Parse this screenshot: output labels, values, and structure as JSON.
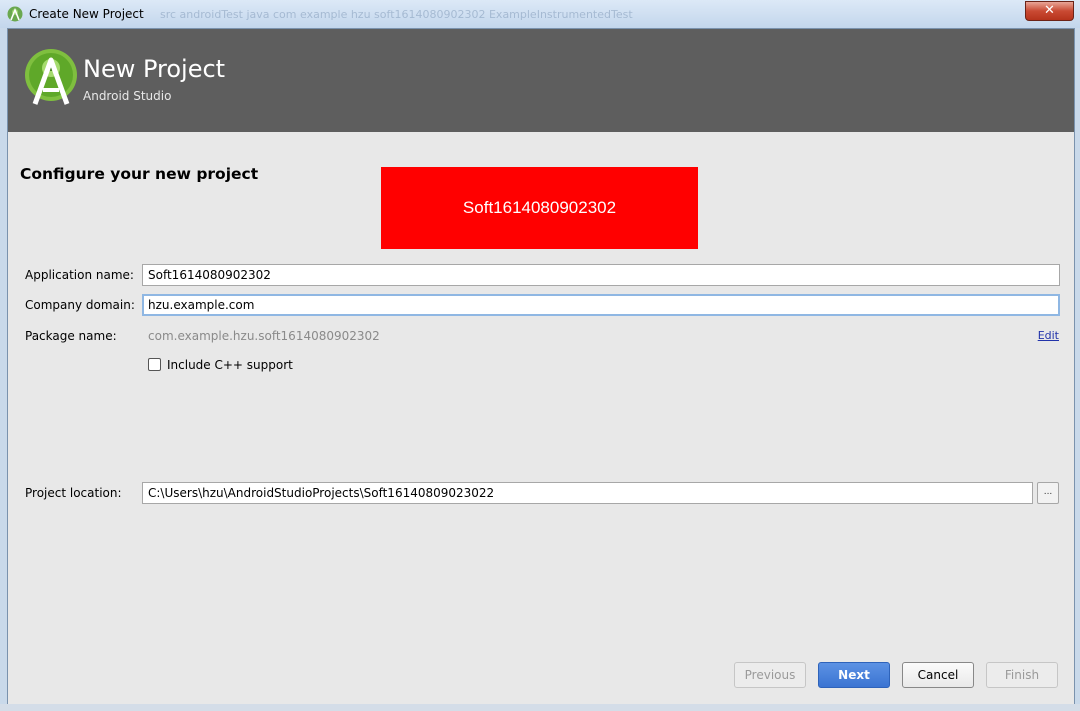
{
  "window": {
    "title": "Create New Project",
    "close_label": "✕",
    "background_crumbs": "src   androidTest   java   com   example   hzu   soft1614080902302   ExampleInstrumentedTest"
  },
  "banner": {
    "title": "New Project",
    "subtitle": "Android Studio"
  },
  "section": {
    "title": "Configure your new project"
  },
  "red_box_text": "Soft1614080902302",
  "form": {
    "app_name_label": "Application name:",
    "app_name_value": "Soft1614080902302",
    "company_domain_label": "Company domain:",
    "company_domain_value": "hzu.example.com",
    "package_name_label": "Package name:",
    "package_name_value": "com.example.hzu.soft1614080902302",
    "edit_link": "Edit",
    "cpp_support_label": "Include C++ support",
    "cpp_support_checked": false,
    "project_location_label": "Project location:",
    "project_location_value": "C:\\Users\\hzu\\AndroidStudioProjects\\Soft16140809023022",
    "browse_label": "..."
  },
  "buttons": {
    "previous": "Previous",
    "next": "Next",
    "cancel": "Cancel",
    "finish": "Finish"
  },
  "colors": {
    "banner_bg": "#5e5e5e",
    "red_box": "#ff0000",
    "primary_button": "#3b74d2",
    "dialog_bg": "#e8e8e8"
  }
}
